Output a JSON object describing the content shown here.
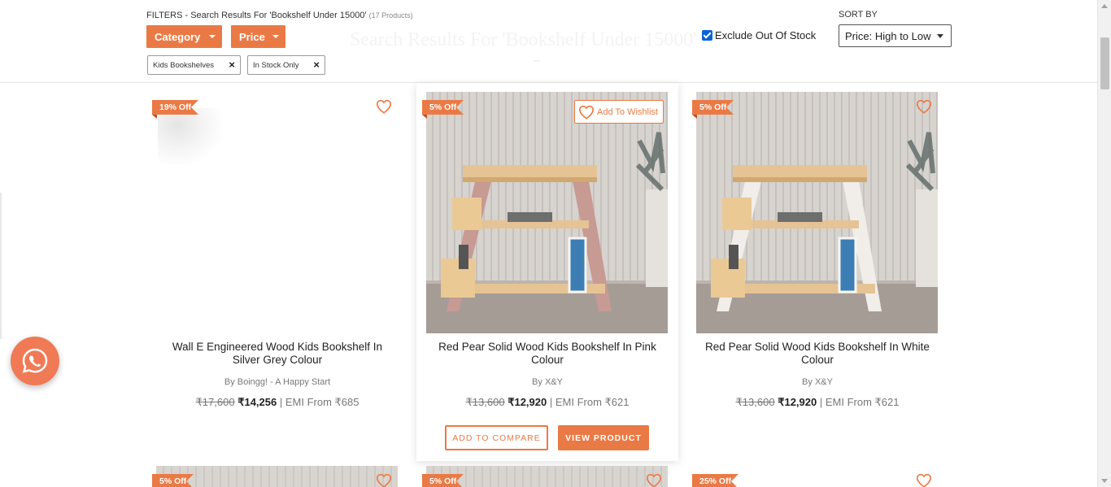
{
  "filters": {
    "heading": "FILTERS - Search Results For 'Bookshelf Under 15000'",
    "count": "(17 Products)",
    "ghost_title": "Search Results For 'Bookshelf Under 15000'",
    "category_label": "Category",
    "price_label": "Price",
    "chips": [
      {
        "label": "Kids Bookshelves"
      },
      {
        "label": "In Stock Only"
      }
    ],
    "exclude_label": "Exclude Out Of Stock",
    "exclude_checked": true,
    "sort_label": "SORT BY",
    "sort_value": "Price: High to Low"
  },
  "products": [
    {
      "discount": "19% Off",
      "title": "Wall E Engineered Wood Kids Bookshelf In Silver Grey Colour",
      "brand": "By Boingg! - A Happy Start",
      "mrp": "₹17,600",
      "price": "₹14,256",
      "emi": "| EMI From ₹685"
    },
    {
      "discount": "5% Off",
      "wishlist_label": "Add To Wishlist",
      "title": "Red Pear Solid Wood Kids Bookshelf In Pink Colour",
      "brand": "By X&Y",
      "mrp": "₹13,600",
      "price": "₹12,920",
      "emi": "| EMI From ₹621",
      "compare_label": "ADD TO COMPARE",
      "view_label": "VIEW PRODUCT",
      "leg_color": "#c79a93"
    },
    {
      "discount": "5% Off",
      "title": "Red Pear Solid Wood Kids Bookshelf In White Colour",
      "brand": "By X&Y",
      "mrp": "₹13,600",
      "price": "₹12,920",
      "emi": "| EMI From ₹621",
      "leg_color": "#f1eeea"
    }
  ],
  "next_row": [
    {
      "discount": "5% Off"
    },
    {
      "discount": "5% Off"
    },
    {
      "discount": "25% Off"
    }
  ],
  "colors": {
    "accent": "#ea7a45",
    "checkbox": "#0a64d3",
    "whatsapp": "#f07a55"
  },
  "icons": {
    "wishlist": "heart-outline-icon",
    "chip_remove": "close-icon",
    "dropdown": "caret-down-icon",
    "chat": "whatsapp-icon"
  }
}
